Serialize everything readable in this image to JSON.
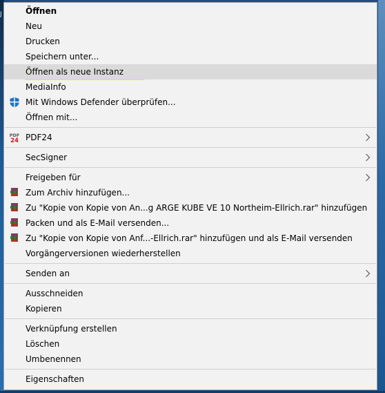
{
  "menu": {
    "open": "Öffnen",
    "new": "Neu",
    "print": "Drucken",
    "save_as": "Speichern unter...",
    "open_new_instance": "Öffnen als neue Instanz",
    "mediainfo": "MediaInfo",
    "defender_scan": "Mit Windows Defender überprüfen...",
    "open_with": "Öffnen mit...",
    "pdf24": "PDF24",
    "secsigner": "SecSigner",
    "share_with": "Freigeben für",
    "add_to_archive": "Zum Archiv hinzufügen...",
    "add_to_named_rar": "Zu \"Kopie von Kopie von An...g ARGE KUBE VE 10 Northeim-Ellrich.rar\" hinzufügen",
    "pack_and_email": "Packen und als E-Mail versenden...",
    "add_to_rar_and_email": "Zu \"Kopie von Kopie von Anf...-Ellrich.rar\" hinzufügen und als E-Mail versenden",
    "restore_previous_versions": "Vorgängerversionen wiederherstellen",
    "send_to": "Senden an",
    "cut": "Ausschneiden",
    "copy": "Kopieren",
    "create_shortcut": "Verknüpfung erstellen",
    "delete": "Löschen",
    "rename": "Umbenennen",
    "properties": "Eigenschaften"
  },
  "pdf24_icon": {
    "top": "PDF",
    "bottom": "24"
  },
  "colors": {
    "menu_bg": "#f2f2f2",
    "hover_bg": "#dadada",
    "highlighter": "#e2ec12",
    "separator": "#cfcfcf"
  }
}
